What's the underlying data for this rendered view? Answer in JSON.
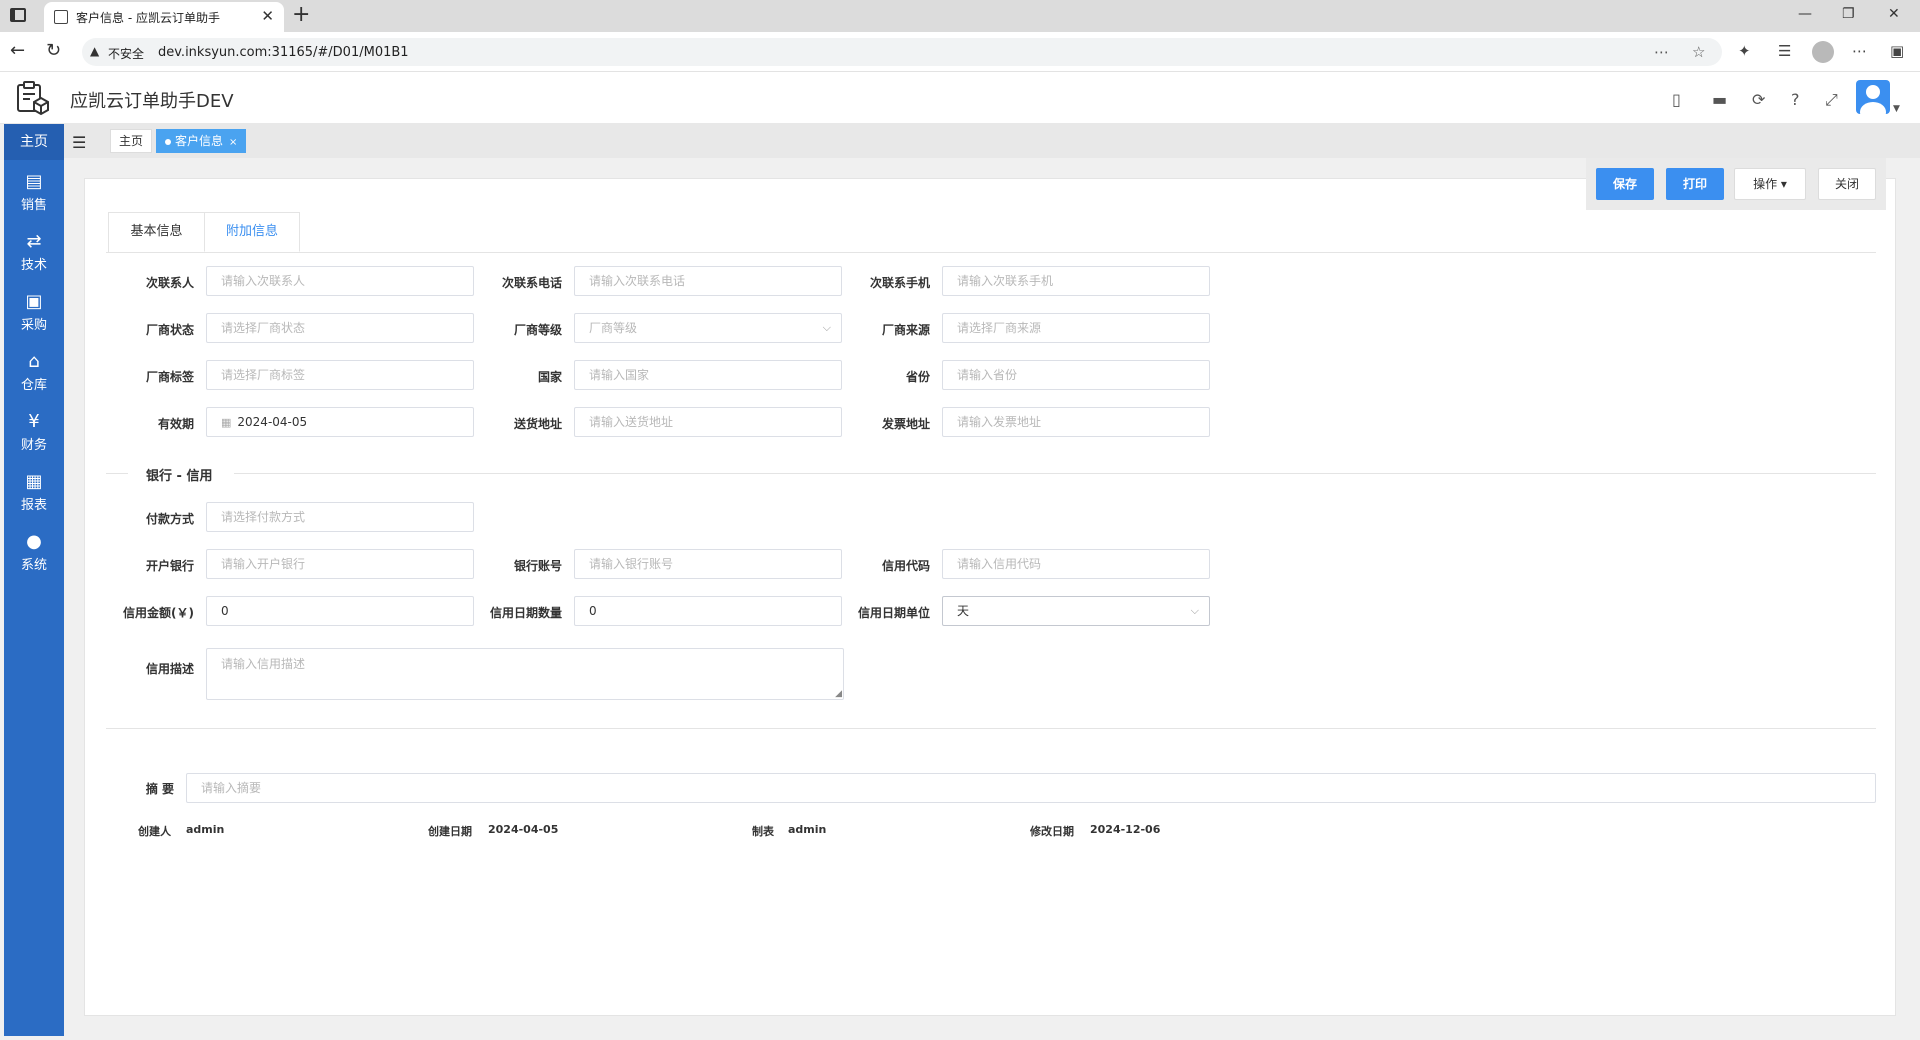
{
  "browser": {
    "tab_title": "客户信息 - 应凯云订单助手",
    "security_label": "不安全",
    "url": "dev.inksyun.com:31165/#/D01/M01B1"
  },
  "app": {
    "title": "应凯云订单助手DEV"
  },
  "sidebar": {
    "home": "主页",
    "items": [
      {
        "label": "销售",
        "icon": "clipboard-icon"
      },
      {
        "label": "技术",
        "icon": "route-icon"
      },
      {
        "label": "采购",
        "icon": "purchase-icon"
      },
      {
        "label": "仓库",
        "icon": "warehouse-icon"
      },
      {
        "label": "财务",
        "icon": "yen-icon"
      },
      {
        "label": "报表",
        "icon": "chart-icon"
      },
      {
        "label": "系统",
        "icon": "user-icon"
      }
    ]
  },
  "tabs": {
    "home": "主页",
    "active": "客户信息",
    "close": "×"
  },
  "actions": {
    "save": "保存",
    "print": "打印",
    "operate": "操作",
    "close": "关闭"
  },
  "form_tabs": {
    "basic": "基本信息",
    "extra": "附加信息"
  },
  "fields": {
    "contact2": {
      "label": "次联系人",
      "placeholder": "请输入次联系人"
    },
    "contact2_phone": {
      "label": "次联系电话",
      "placeholder": "请输入次联系电话"
    },
    "contact2_mobile": {
      "label": "次联系手机",
      "placeholder": "请输入次联系手机"
    },
    "vendor_status": {
      "label": "厂商状态",
      "placeholder": "请选择厂商状态"
    },
    "vendor_level": {
      "label": "厂商等级",
      "placeholder": "厂商等级"
    },
    "vendor_source": {
      "label": "厂商来源",
      "placeholder": "请选择厂商来源"
    },
    "vendor_tag": {
      "label": "厂商标签",
      "placeholder": "请选择厂商标签"
    },
    "country": {
      "label": "国家",
      "placeholder": "请输入国家"
    },
    "province": {
      "label": "省份",
      "placeholder": "请输入省份"
    },
    "valid_date": {
      "label": "有效期",
      "value": "2024-04-05"
    },
    "ship_address": {
      "label": "送货地址",
      "placeholder": "请输入送货地址"
    },
    "invoice_address": {
      "label": "发票地址",
      "placeholder": "请输入发票地址"
    },
    "payment_method": {
      "label": "付款方式",
      "placeholder": "请选择付款方式"
    },
    "bank": {
      "label": "开户银行",
      "placeholder": "请输入开户银行"
    },
    "bank_account": {
      "label": "银行账号",
      "placeholder": "请输入银行账号"
    },
    "credit_code": {
      "label": "信用代码",
      "placeholder": "请输入信用代码"
    },
    "credit_amount": {
      "label": "信用金额(￥)",
      "value": "0"
    },
    "credit_days": {
      "label": "信用日期数量",
      "value": "0"
    },
    "credit_unit": {
      "label": "信用日期单位",
      "value": "天"
    },
    "credit_desc": {
      "label": "信用描述",
      "placeholder": "请输入信用描述"
    },
    "summary": {
      "label": "摘 要",
      "placeholder": "请输入摘要"
    }
  },
  "section": {
    "bank_credit": "银行 - 信用"
  },
  "meta": {
    "creator_label": "创建人",
    "creator": "admin",
    "created_label": "创建日期",
    "created": "2024-04-05",
    "maker_label": "制表",
    "maker": "admin",
    "modified_label": "修改日期",
    "modified": "2024-12-06"
  }
}
